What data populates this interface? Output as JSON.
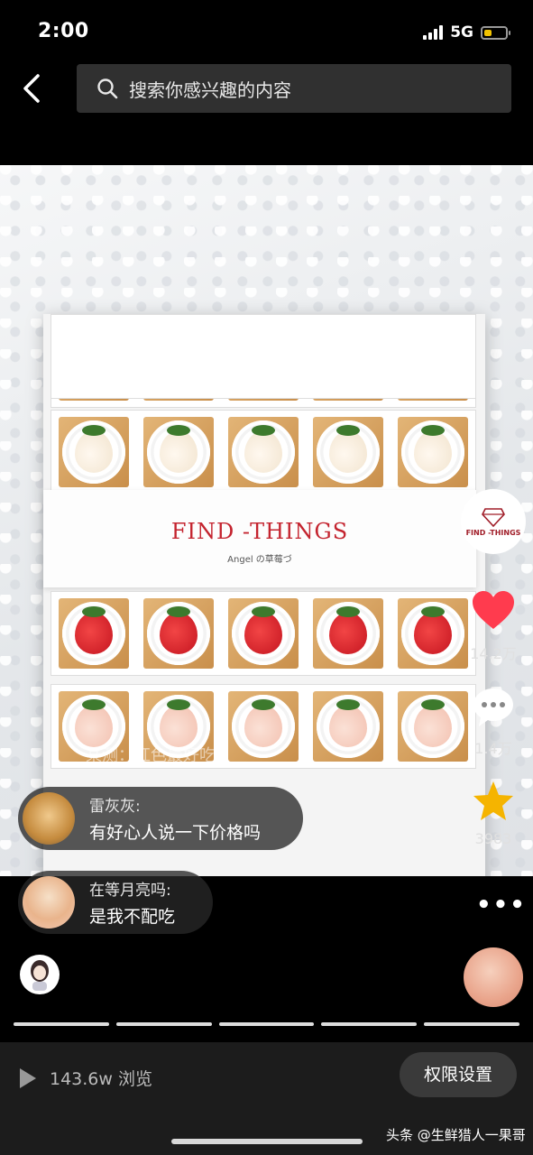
{
  "status": {
    "time": "2:00",
    "network": "5G"
  },
  "search": {
    "placeholder": "搜索你感兴趣的内容"
  },
  "post": {
    "brand_title": "FIND -THINGS",
    "brand_subtitle": "Angel の草莓づ",
    "watermark": "某测：红色最好吃"
  },
  "rail": {
    "brand_badge": "FIND -THINGS",
    "likes": "14.2万",
    "comments": "1.4万",
    "favorites": "3983"
  },
  "comments": [
    {
      "name": "雷灰灰:",
      "text": "有好心人说一下价格吗"
    },
    {
      "name": "在等月亮吗:",
      "text": "是我不配吃"
    }
  ],
  "footer": {
    "views": "143.6w 浏览",
    "permission_button": "权限设置",
    "source_tag": "头条 @生鲜猎人一果哥"
  },
  "colors": {
    "like": "#ff3b4e",
    "star": "#f5b400",
    "brand_red": "#c4242f"
  },
  "icons": [
    "back-icon",
    "search-icon",
    "heart-icon",
    "comment-icon",
    "star-icon",
    "more-icon",
    "play-icon"
  ]
}
